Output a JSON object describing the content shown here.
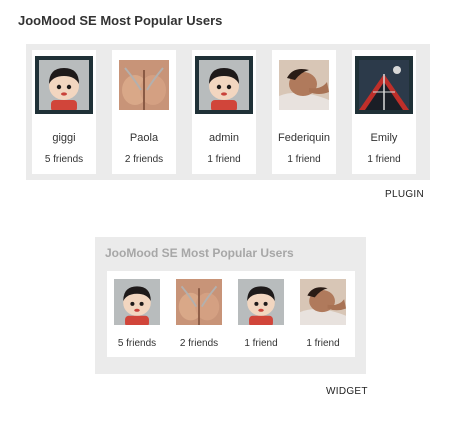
{
  "plugin": {
    "title": "JooMood SE Most Popular Users",
    "label": "PLUGIN",
    "users": [
      {
        "name": "giggi",
        "friends": "5 friends",
        "avatar": "cartoon-boy-avatar"
      },
      {
        "name": "Paola",
        "friends": "2 friends",
        "avatar": "photo-avatar"
      },
      {
        "name": "admin",
        "friends": "1 friend",
        "avatar": "cartoon-boy-avatar"
      },
      {
        "name": "Federiquin",
        "friends": "1 friend",
        "avatar": "photo-avatar"
      },
      {
        "name": "Emily",
        "friends": "1 friend",
        "avatar": "artwork-avatar"
      }
    ]
  },
  "widget": {
    "title": "JooMood SE Most Popular Users",
    "label": "WIDGET",
    "users": [
      {
        "friends": "5 friends",
        "avatar": "cartoon-boy-avatar"
      },
      {
        "friends": "2 friends",
        "avatar": "photo-avatar"
      },
      {
        "friends": "1 friend",
        "avatar": "cartoon-boy-avatar"
      },
      {
        "friends": "1 friend",
        "avatar": "photo-avatar"
      }
    ]
  },
  "colors": {
    "panel_bg": "#ebebeb",
    "avatar_frame": "#1f3137",
    "widget_title": "#a7a7a7",
    "text": "#333333"
  }
}
